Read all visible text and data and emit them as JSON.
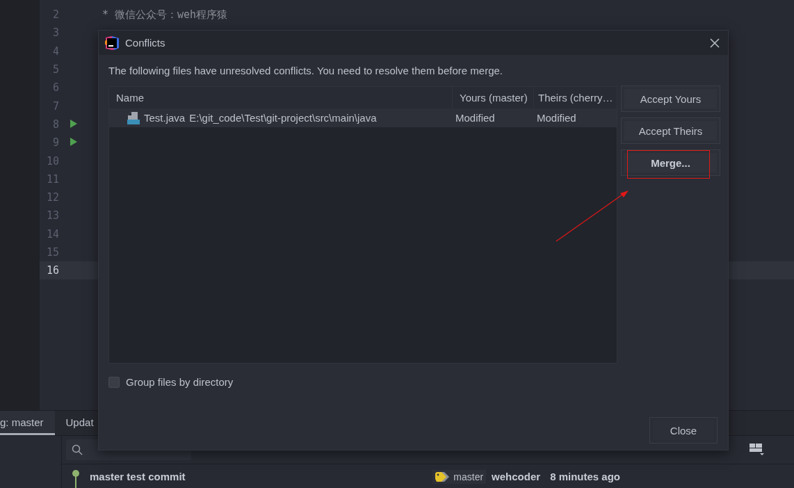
{
  "editor": {
    "lines": [
      {
        "number": "2",
        "code": "* 微信公众号：weh程序猿",
        "run": false,
        "current": false
      },
      {
        "number": "3",
        "run": false,
        "current": false
      },
      {
        "number": "4",
        "run": false,
        "current": false
      },
      {
        "number": "5",
        "run": false,
        "current": false
      },
      {
        "number": "6",
        "run": false,
        "current": false
      },
      {
        "number": "7",
        "run": false,
        "current": false
      },
      {
        "number": "8",
        "run": true,
        "current": false
      },
      {
        "number": "9",
        "run": true,
        "current": false
      },
      {
        "number": "10",
        "run": false,
        "current": false
      },
      {
        "number": "11",
        "run": false,
        "current": false
      },
      {
        "number": "12",
        "run": false,
        "current": false
      },
      {
        "number": "13",
        "run": false,
        "current": false
      },
      {
        "number": "14",
        "run": false,
        "current": false
      },
      {
        "number": "15",
        "run": false,
        "current": false
      },
      {
        "number": "16",
        "run": false,
        "current": true
      }
    ]
  },
  "bottom_panel": {
    "tabs": [
      {
        "label": "g: master",
        "selected": true
      },
      {
        "label": "Updat",
        "selected": false
      }
    ],
    "commits": [
      {
        "message": "master test commit",
        "tag": "master",
        "author": "wehcoder",
        "time": "8 minutes ago"
      }
    ]
  },
  "dialog": {
    "title": "Conflicts",
    "message": "The following files have unresolved conflicts. You need to resolve them before merge.",
    "table": {
      "columns": [
        "Name",
        "Yours (master)",
        "Theirs (cherry…"
      ],
      "rows": [
        {
          "file": "Test.java",
          "path": "E:\\git_code\\Test\\git-project\\src\\main\\java",
          "yours": "Modified",
          "theirs": "Modified",
          "selected": true
        }
      ]
    },
    "side_buttons": [
      {
        "label": "Accept Yours",
        "default": false
      },
      {
        "label": "Accept Theirs",
        "default": false
      },
      {
        "label": "Merge...",
        "default": true
      }
    ],
    "group_by_directory": {
      "label": "Group files by directory",
      "checked": false
    },
    "close_button": "Close"
  }
}
